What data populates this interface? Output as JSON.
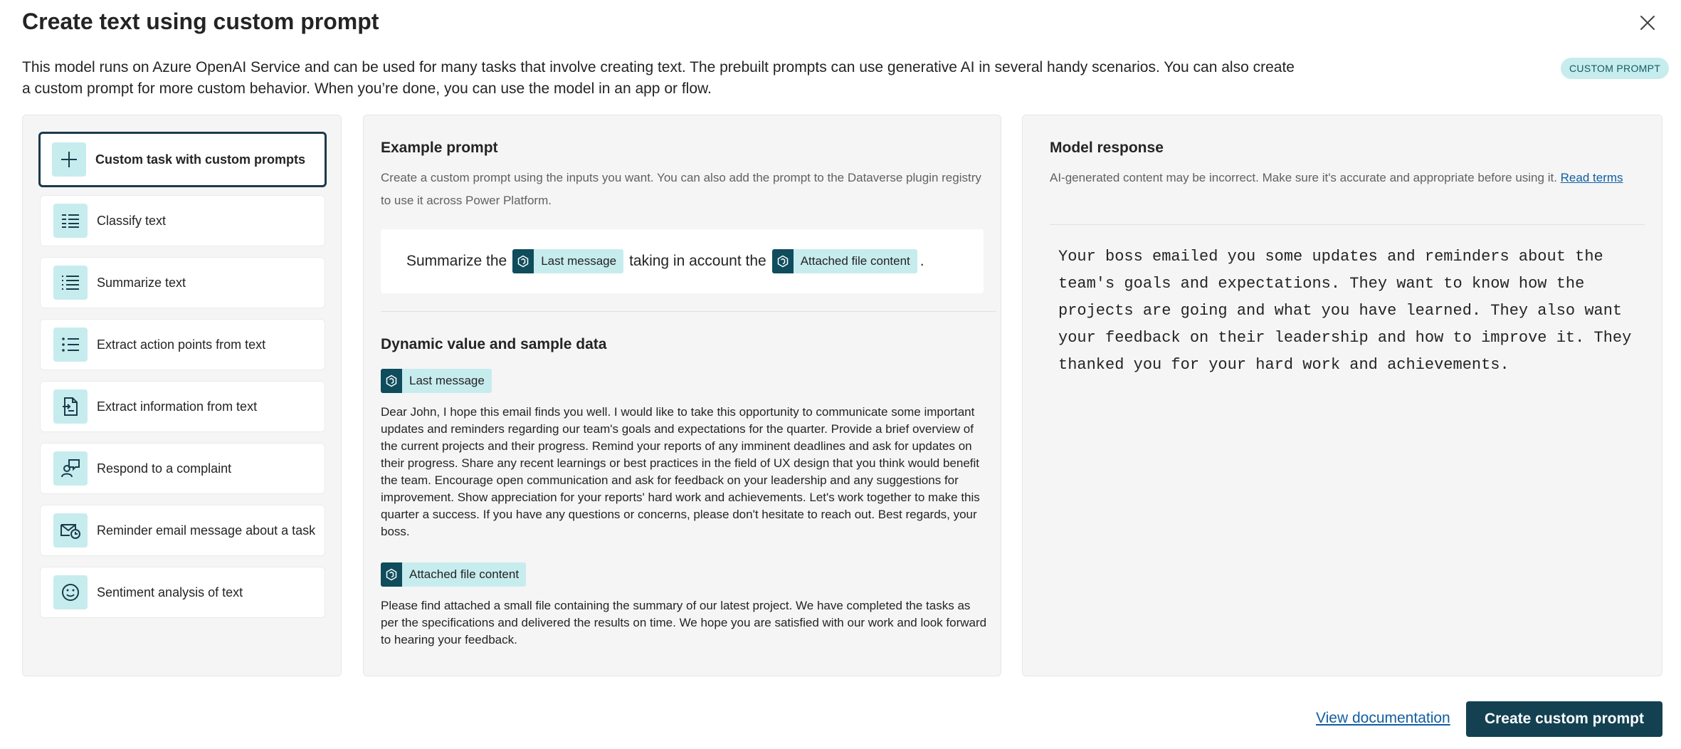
{
  "dialog": {
    "title": "Create text using custom prompt",
    "description": "This model runs on Azure OpenAI Service and can be used for many tasks that involve creating text. The prebuilt prompts can use generative AI in several handy scenarios. You can also create a custom prompt for more custom behavior. When you’re done, you can use the model in an app or flow.",
    "badge": "CUSTOM PROMPT"
  },
  "tasks": [
    {
      "label": "Custom task with custom prompts",
      "icon": "plus-icon",
      "selected": true
    },
    {
      "label": "Classify text",
      "icon": "classify-icon",
      "selected": false
    },
    {
      "label": "Summarize text",
      "icon": "summarize-icon",
      "selected": false
    },
    {
      "label": "Extract action points from text",
      "icon": "bulleted-list-icon",
      "selected": false
    },
    {
      "label": "Extract information from text",
      "icon": "document-extract-icon",
      "selected": false
    },
    {
      "label": "Respond to a complaint",
      "icon": "person-feedback-icon",
      "selected": false
    },
    {
      "label": "Reminder email message about a task",
      "icon": "mail-clock-icon",
      "selected": false
    },
    {
      "label": "Sentiment analysis of text",
      "icon": "emoji-smile-icon",
      "selected": false
    }
  ],
  "example": {
    "title": "Example prompt",
    "subtitle": "Create a custom prompt using the inputs you want. You can also add the prompt to the Dataverse plugin registry to use it across Power Platform.",
    "prompt_part1": "Summarize the",
    "chip1": "Last message",
    "prompt_part2": "taking in account the",
    "chip2": "Attached file content",
    "prompt_part3": "."
  },
  "dynamic": {
    "title": "Dynamic value and sample data",
    "value1_label": "Last message",
    "value1_text": "Dear John, I hope this email finds you well. I would like to take this opportunity to communicate some important updates and reminders regarding our team's goals and expectations for the quarter. Provide a brief overview of the current projects and their progress. Remind your reports of any imminent deadlines and ask for updates on their progress. Share any recent learnings or best practices in the field of UX design that you think would benefit the team. Encourage open communication and ask for feedback on your leadership and any suggestions for improvement. Show appreciation for your reports' hard work and achievements. Let's work together to make this quarter a success. If you have any questions or concerns, please don't hesitate to reach out. Best regards, your boss.",
    "value2_label": "Attached file content",
    "value2_text": "Please find attached a small file containing the summary of our latest project. We have completed the tasks as per the specifications and delivered the results on time. We hope you are satisfied with our work and look forward to hearing your feedback."
  },
  "response": {
    "title": "Model response",
    "disclaimer": "AI-generated content may be incorrect. Make sure it's accurate and appropriate before using it.",
    "read_terms": "Read terms",
    "text": "Your boss emailed you some updates and reminders about the team's goals and expectations. They want to know how the projects are going and what you have learned. They also want your feedback on their leadership and how to improve it. They thanked you for your hard work and achievements."
  },
  "footer": {
    "view_documentation": "View documentation",
    "create_button": "Create custom prompt"
  },
  "colors": {
    "accent": "#134152",
    "chip_bg": "#c7ecee",
    "chip_icon_bg": "#0f4c5c",
    "link": "#115ea3"
  }
}
